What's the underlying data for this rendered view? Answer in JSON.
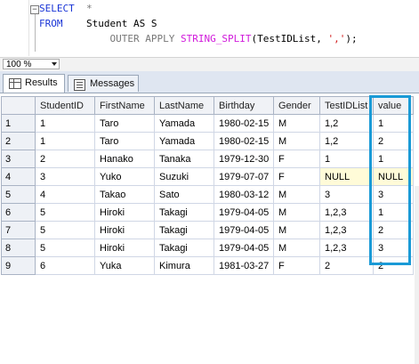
{
  "query": {
    "line1": {
      "kw": "SELECT",
      "rest": "  *"
    },
    "line2": {
      "kw": "FROM",
      "rest": "    Student AS S"
    },
    "line3": {
      "pad": "            ",
      "kw": "OUTER APPLY",
      "fn": "STRING_SPLIT",
      "args": "(TestIDList, ",
      "str": "','",
      "end": ");"
    },
    "fold_symbol": "−"
  },
  "zoom": {
    "value": "100 %"
  },
  "tabs": [
    {
      "label": "Results",
      "icon": "grid-icon"
    },
    {
      "label": "Messages",
      "icon": "messages-icon"
    }
  ],
  "grid": {
    "columns": [
      "StudentID",
      "FirstName",
      "LastName",
      "Birthday",
      "Gender",
      "TestIDList",
      "value"
    ],
    "rows": [
      {
        "n": "1",
        "cells": [
          "1",
          "Taro",
          "Yamada",
          "1980-02-15",
          "M",
          "1,2",
          "1"
        ]
      },
      {
        "n": "2",
        "cells": [
          "1",
          "Taro",
          "Yamada",
          "1980-02-15",
          "M",
          "1,2",
          "2"
        ]
      },
      {
        "n": "3",
        "cells": [
          "2",
          "Hanako",
          "Tanaka",
          "1979-12-30",
          "F",
          "1",
          "1"
        ]
      },
      {
        "n": "4",
        "cells": [
          "3",
          "Yuko",
          "Suzuki",
          "1979-07-07",
          "F",
          "NULL",
          "NULL"
        ]
      },
      {
        "n": "5",
        "cells": [
          "4",
          "Takao",
          "Sato",
          "1980-03-12",
          "M",
          "3",
          "3"
        ]
      },
      {
        "n": "6",
        "cells": [
          "5",
          "Hiroki",
          "Takagi",
          "1979-04-05",
          "M",
          "1,2,3",
          "1"
        ]
      },
      {
        "n": "7",
        "cells": [
          "5",
          "Hiroki",
          "Takagi",
          "1979-04-05",
          "M",
          "1,2,3",
          "2"
        ]
      },
      {
        "n": "8",
        "cells": [
          "5",
          "Hiroki",
          "Takagi",
          "1979-04-05",
          "M",
          "1,2,3",
          "3"
        ]
      },
      {
        "n": "9",
        "cells": [
          "6",
          "Yuka",
          "Kimura",
          "1981-03-27",
          "F",
          "2",
          "2"
        ]
      }
    ]
  },
  "colors": {
    "keyword": "#1a35d6",
    "function": "#d11adb",
    "string": "#d11b1b",
    "highlight": "#1a9ad6",
    "null_bg": "#fffbd8"
  }
}
